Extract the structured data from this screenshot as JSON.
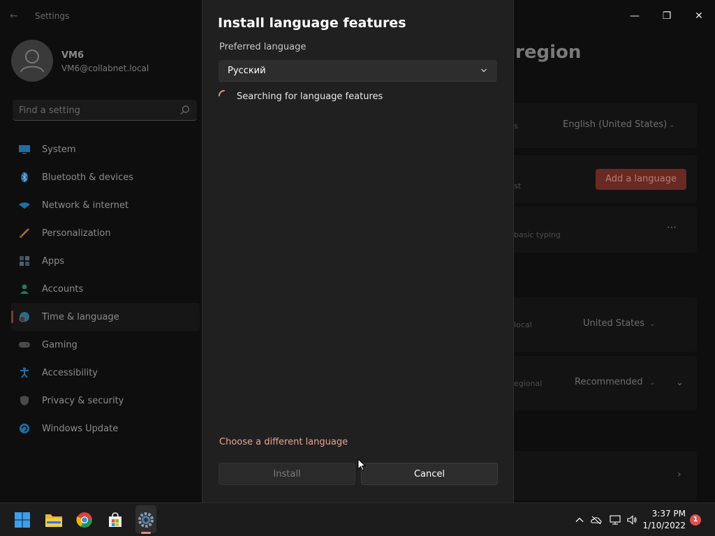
{
  "settings": {
    "app_title": "Settings",
    "user": {
      "name": "VM6",
      "email": "VM6@collabnet.local"
    },
    "search": {
      "placeholder": "Find a setting"
    },
    "nav": [
      {
        "label": "System",
        "icon": "monitor-icon"
      },
      {
        "label": "Bluetooth & devices",
        "icon": "bluetooth-icon"
      },
      {
        "label": "Network & internet",
        "icon": "wifi-icon"
      },
      {
        "label": "Personalization",
        "icon": "brush-icon"
      },
      {
        "label": "Apps",
        "icon": "apps-icon"
      },
      {
        "label": "Accounts",
        "icon": "person-icon"
      },
      {
        "label": "Time & language",
        "icon": "globe-clock-icon",
        "selected": true
      },
      {
        "label": "Gaming",
        "icon": "gamepad-icon"
      },
      {
        "label": "Accessibility",
        "icon": "accessibility-icon"
      },
      {
        "label": "Privacy & security",
        "icon": "shield-icon"
      },
      {
        "label": "Windows Update",
        "icon": "update-icon"
      }
    ],
    "background": {
      "page_title_partial": "region",
      "display_language_hint": "s",
      "display_language_value": "English (United States)",
      "add_language_button": "Add a language",
      "preferred_hint": "st",
      "basic_typing_hint": "basic typing",
      "region_hint": "local",
      "region_value": "United States",
      "format_hint": "egional",
      "format_value": "Recommended"
    }
  },
  "dialog": {
    "title": "Install language features",
    "preferred_label": "Preferred language",
    "preferred_value": "Русский",
    "searching_text": "Searching for language features",
    "choose_link": "Choose a different language",
    "install_button": "Install",
    "cancel_button": "Cancel"
  },
  "taskbar": {
    "apps": [
      "start-icon",
      "file-explorer-icon",
      "chrome-icon",
      "store-icon",
      "settings-gear-icon"
    ],
    "time": "3:37 PM",
    "date": "1/10/2022",
    "notification_count": "1"
  },
  "colors": {
    "accent": "#e58f7f",
    "link": "#e9a596",
    "dialog_bg": "#202020"
  }
}
